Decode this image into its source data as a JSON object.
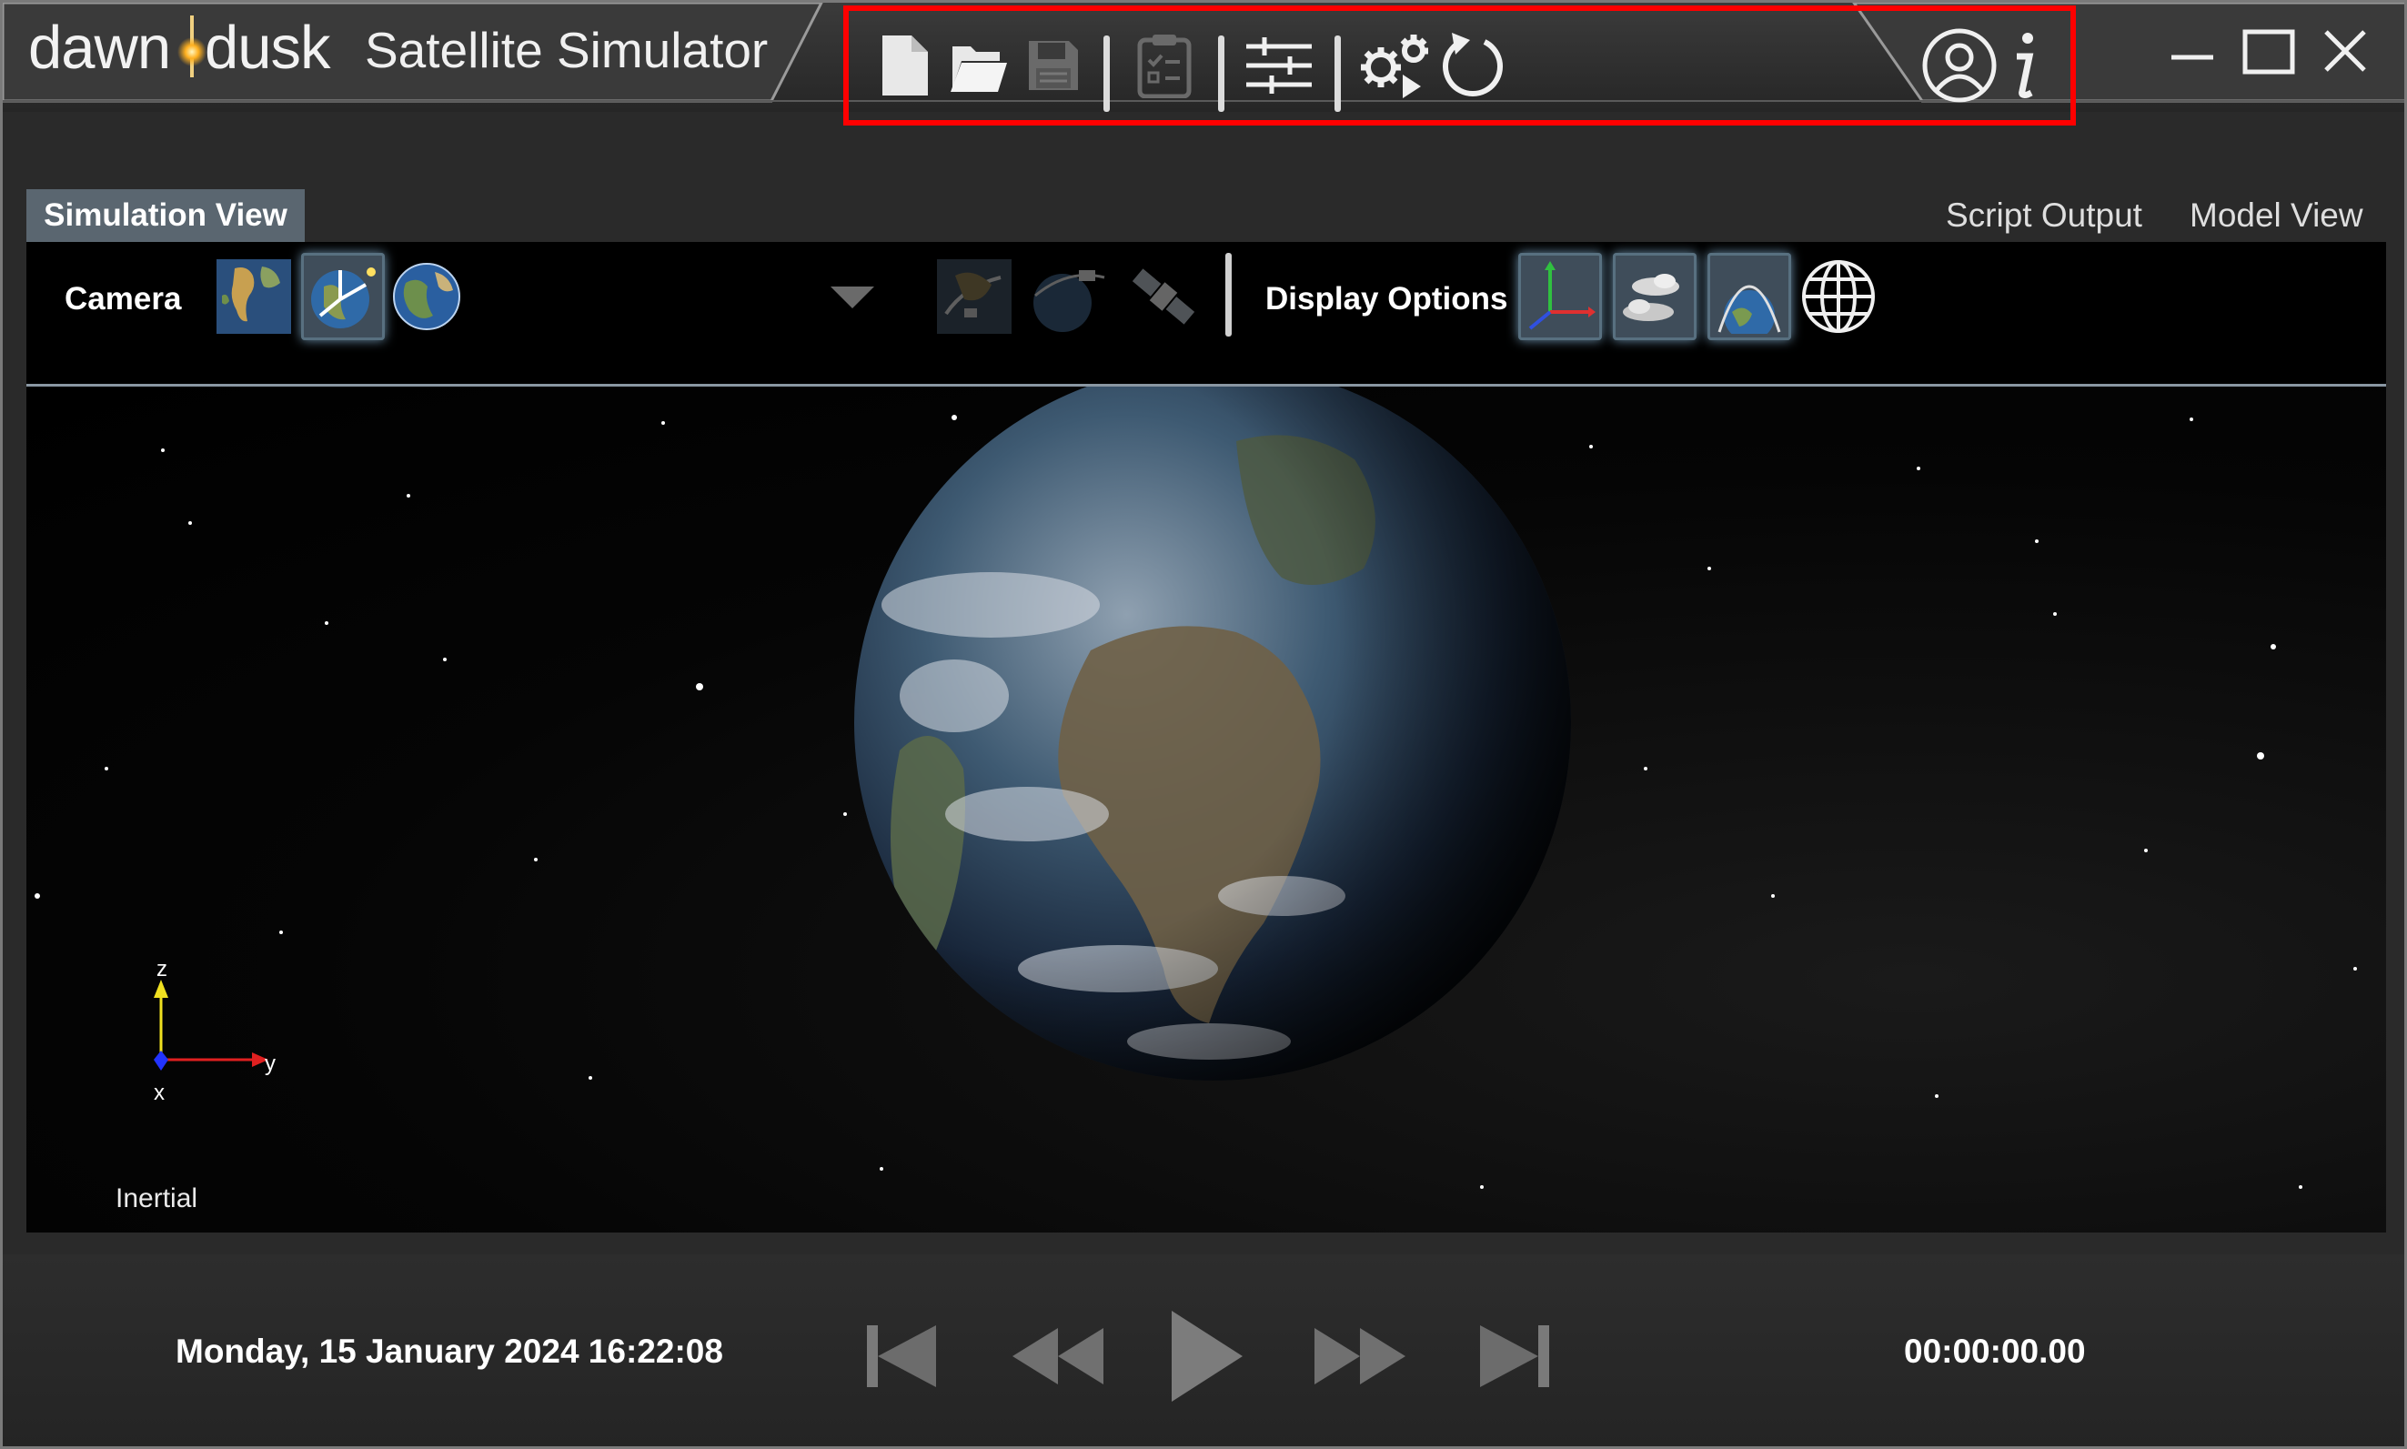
{
  "app": {
    "brand_left": "dawn",
    "brand_right": "dusk",
    "title": "Satellite Simulator"
  },
  "toolbar": {
    "items": [
      {
        "name": "new-file",
        "icon": "new-file-icon"
      },
      {
        "name": "open-folder",
        "icon": "open-folder-icon"
      },
      {
        "name": "save",
        "icon": "save-icon",
        "state": "disabled"
      },
      {
        "name": "clipboard",
        "icon": "clipboard-checklist-icon",
        "state": "disabled"
      },
      {
        "name": "settings-sliders",
        "icon": "sliders-icon"
      },
      {
        "name": "run",
        "icon": "gears-run-icon"
      },
      {
        "name": "reset",
        "icon": "reset-icon"
      }
    ],
    "right_icons": [
      "user-account-icon",
      "info-icon"
    ],
    "highlight_color": "#ff0000"
  },
  "window_controls": [
    "minimize-icon",
    "maximize-icon",
    "close-icon"
  ],
  "tabs": {
    "simulation_view": "Simulation View",
    "script_output": "Script Output",
    "model_view": "Model View"
  },
  "view_toolbar": {
    "camera_label": "Camera",
    "display_options_label": "Display Options",
    "camera_buttons": [
      "earth-map-icon",
      "earth-axes-icon",
      "globe-icon"
    ],
    "satellite_buttons": [
      "satellite-earth-icon",
      "satellite-orbit-icon",
      "satellite-icon"
    ],
    "display_buttons": [
      "axes-icon",
      "clouds-icon",
      "atmosphere-icon",
      "wireframe-globe-icon"
    ]
  },
  "scene": {
    "frame_label": "Inertial",
    "axes": {
      "z": "z",
      "y": "y",
      "x": "x"
    }
  },
  "playback": {
    "datetime": "Monday, 15 January 2024 16:22:08",
    "elapsed": "00:00:00.00",
    "buttons": [
      "skip-to-start-icon",
      "rewind-icon",
      "play-icon",
      "fast-forward-icon",
      "skip-to-end-icon"
    ]
  },
  "colors": {
    "tab_active": "#5a6670",
    "button_active": "#3f4d5a",
    "axis_x": "#2233ff",
    "axis_y": "#e02020",
    "axis_z": "#f0e020"
  }
}
